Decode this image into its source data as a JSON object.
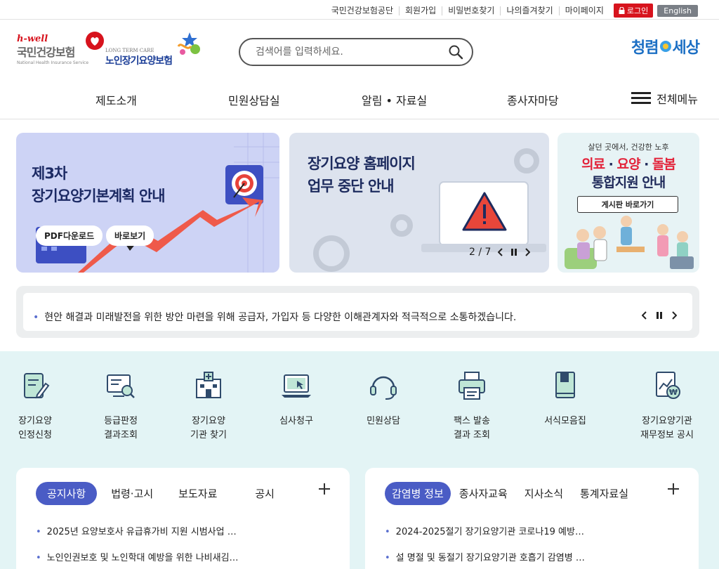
{
  "top_links": [
    "국민건강보험공단",
    "회원가입",
    "비밀번호찾기",
    "나의즐겨찾기",
    "마이페이지"
  ],
  "login_label": "로그인",
  "english_label": "English",
  "logo": {
    "hwell": "h-well",
    "nhis_name": "국민건강보험",
    "nhis_en": "National Health Insurance Service",
    "ltc_en": "LONG TERM CARE",
    "ltc_name": "노인장기요양보험"
  },
  "search": {
    "placeholder": "검색어를 입력하세요."
  },
  "brand_right": {
    "left": "청렴",
    "right": "세상"
  },
  "nav": [
    "제도소개",
    "민원상담실",
    "알림 • 자료실",
    "종사자마당"
  ],
  "all_menu": "전체메뉴",
  "banners": {
    "b1": {
      "line1": "제3차",
      "line2": "장기요양기본계획 안내",
      "btn_pdf": "PDF다운로드",
      "btn_view": "바로보기"
    },
    "b2": {
      "line1": "장기요양 홈페이지",
      "line2": "업무 중단 안내",
      "pager": "2 / 7"
    },
    "b3": {
      "sub": "살던 곳에서, 건강한 노후",
      "line1a": "의료",
      "line1b": " · ",
      "line1c": "요양",
      "line1d": " · ",
      "line1e": "돌봄",
      "line2": "통합지원 안내",
      "btn": "게시판 바로가기"
    }
  },
  "ticker": "현안 해결과 미래발전을 위한 방안 마련을 위해 공급자, 가입자 등 다양한 이해관계자와 적극적으로 소통하겠습니다.",
  "quick_menu": [
    {
      "l1": "장기요양",
      "l2": "인정신청"
    },
    {
      "l1": "등급판정",
      "l2": "결과조회"
    },
    {
      "l1": "장기요양",
      "l2": "기관 찾기"
    },
    {
      "l1": "심사청구",
      "l2": ""
    },
    {
      "l1": "민원상담",
      "l2": ""
    },
    {
      "l1": "팩스 발송",
      "l2": "결과 조회"
    },
    {
      "l1": "서식모음집",
      "l2": ""
    },
    {
      "l1": "장기요양기관",
      "l2": "재무정보 공시"
    }
  ],
  "board1": {
    "tabs": [
      "공지사항",
      "법령·고시",
      "보도자료",
      "공시"
    ],
    "posts": [
      "2025년 요양보호사 유급휴가비 지원 시범사업 …",
      "노인인권보호 및 노인학대 예방을 위한 나비새김…"
    ]
  },
  "board2": {
    "tabs": [
      "감염병 정보",
      "종사자교육",
      "지사소식",
      "통계자료실"
    ],
    "posts": [
      "2024-2025절기 장기요양기관 코로나19 예방…",
      "설 명절 및 동절기 장기요양기관 호흡기 감염병 …"
    ]
  },
  "colors": {
    "accent": "#4a5cc5",
    "login_red": "#d7131d",
    "quick_bg": "#e3f4f5"
  }
}
